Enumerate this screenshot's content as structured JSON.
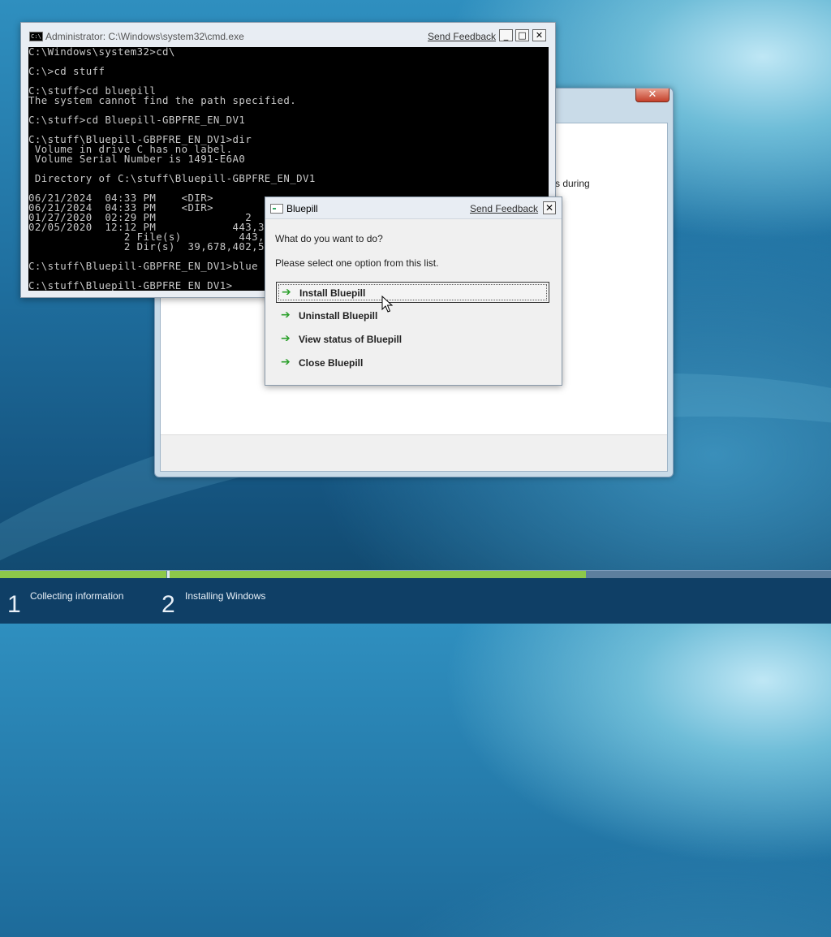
{
  "setup": {
    "close_glyph": "✕",
    "partial_text": "s during"
  },
  "cmd": {
    "title": "Administrator: C:\\Windows\\system32\\cmd.exe",
    "icon_text": "C:\\",
    "send_feedback": "Send Feedback",
    "minimize_glyph": "_",
    "maximize_glyph": "□",
    "close_glyph": "✕",
    "console_text": "C:\\Windows\\system32>cd\\\n\nC:\\>cd stuff\n\nC:\\stuff>cd bluepill\nThe system cannot find the path specified.\n\nC:\\stuff>cd Bluepill-GBPFRE_EN_DV1\n\nC:\\stuff\\Bluepill-GBPFRE_EN_DV1>dir\n Volume in drive C has no label.\n Volume Serial Number is 1491-E6A0\n\n Directory of C:\\stuff\\Bluepill-GBPFRE_EN_DV1\n\n06/21/2024  04:33 PM    <DIR>\n06/21/2024  04:33 PM    <DIR>\n01/27/2020  02:29 PM              2\n02/05/2020  12:12 PM            443,3\n               2 File(s)         443,6\n               2 Dir(s)  39,678,402,5\n\nC:\\stuff\\Bluepill-GBPFRE_EN_DV1>blue\n\nC:\\stuff\\Bluepill-GBPFRE_EN_DV1>"
  },
  "bluepill": {
    "title": "Bluepill",
    "send_feedback": "Send Feedback",
    "close_glyph": "✕",
    "question": "What do you want to do?",
    "instruction": "Please select one option from this list.",
    "arrow_glyph": "➔",
    "options": [
      {
        "label": "Install Bluepill",
        "selected": true
      },
      {
        "label": "Uninstall Bluepill",
        "selected": false
      },
      {
        "label": "View status of Bluepill",
        "selected": false
      },
      {
        "label": "Close Bluepill",
        "selected": false
      }
    ]
  },
  "progress": {
    "steps": [
      {
        "number": "1",
        "label": "Collecting information"
      },
      {
        "number": "2",
        "label": "Installing Windows"
      }
    ],
    "install_progress_fraction": 0.63,
    "colors": {
      "done": "#8dc84a",
      "track": "#5d7f9e"
    }
  }
}
